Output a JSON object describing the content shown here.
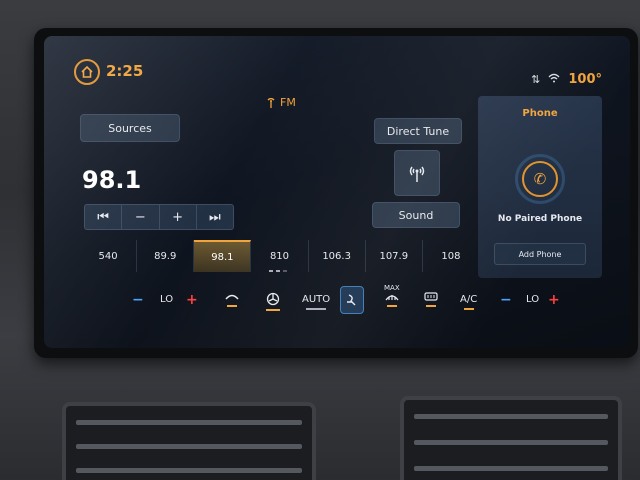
{
  "header": {
    "time": "2:25",
    "temperature": "100°"
  },
  "source": {
    "band": "FM",
    "frequency": "98.1",
    "sources_label": "Sources",
    "direct_tune_label": "Direct Tune",
    "sound_label": "Sound"
  },
  "controls": {
    "seek_back": "⏮",
    "minus": "−",
    "plus": "+",
    "seek_fwd": "⏭"
  },
  "presets": [
    "540",
    "89.9",
    "98.1",
    "810",
    "106.3",
    "107.9",
    "108"
  ],
  "selected_preset": "98.1",
  "phone": {
    "title": "Phone",
    "status": "No Paired Phone",
    "add_label": "Add Phone"
  },
  "climate": {
    "left_temp": "LO",
    "right_temp": "LO",
    "auto_label": "AUTO",
    "max_label": "MAX",
    "ac_label": "A/C",
    "minus": "−",
    "plus": "+"
  },
  "colors": {
    "accent": "#f2a33a",
    "panel": "#2a3748"
  }
}
